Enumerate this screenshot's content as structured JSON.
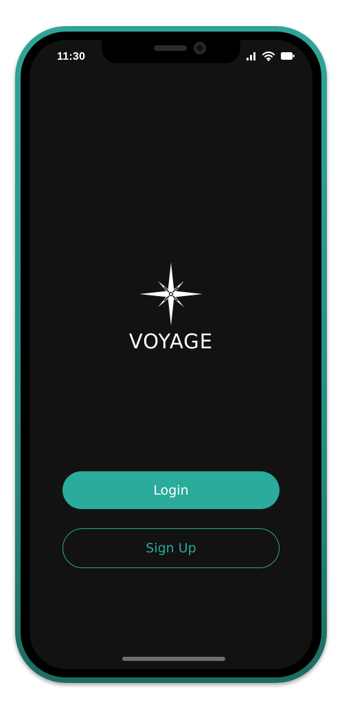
{
  "status_bar": {
    "time": "11:30",
    "icons": [
      "signal-icon",
      "wifi-icon",
      "battery-icon"
    ]
  },
  "brand": {
    "logo_icon": "compass-star-icon",
    "name": "VOYAGE"
  },
  "actions": {
    "login_label": "Login",
    "signup_label": "Sign Up"
  },
  "colors": {
    "accent": "#2aab9b",
    "frame": "#2fa597",
    "background": "#121212",
    "text": "#ffffff"
  }
}
